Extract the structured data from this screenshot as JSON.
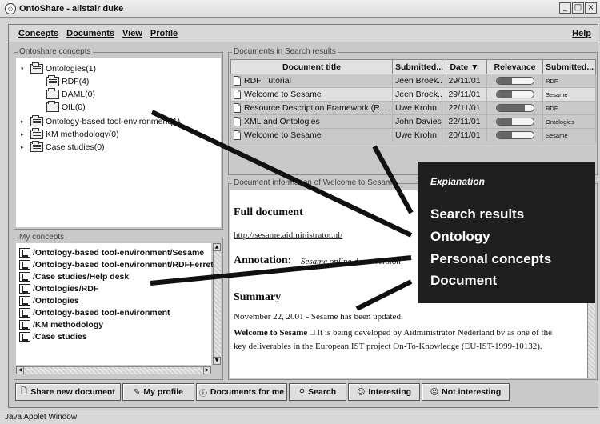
{
  "window": {
    "title": "OntoShare - alistair duke",
    "buttons": [
      "_",
      "□",
      "×"
    ]
  },
  "menu": {
    "items": [
      "Concepts",
      "Documents",
      "View",
      "Profile"
    ],
    "help": "Help"
  },
  "concepts_panel": {
    "label": "Ontoshare concepts",
    "tree": [
      {
        "label": "Ontologies(1)",
        "toggle": "▾"
      },
      {
        "label": "RDF(4)"
      },
      {
        "label": "DAML(0)"
      },
      {
        "label": "OIL(0)"
      },
      {
        "label": "Ontology-based tool-environment(1)",
        "toggle": "▸"
      },
      {
        "label": "KM methodology(0)",
        "toggle": "▸"
      },
      {
        "label": "Case studies(0)",
        "toggle": "▸"
      }
    ]
  },
  "search_panel": {
    "label": "Documents in Search results",
    "columns": [
      "Document title",
      "Submitted...",
      "Date ▼",
      "Relevance",
      "Submitted..."
    ],
    "rows": [
      {
        "title": "RDF Tutorial",
        "submitter": "Jeen Broek...",
        "date": "29/11/01",
        "relevance": 0.42,
        "concept": "RDF"
      },
      {
        "title": "Welcome to Sesame",
        "submitter": "Jeen Broek...",
        "date": "29/11/01",
        "relevance": 0.42,
        "concept": "Sesame"
      },
      {
        "title": "Resource Description Framework (R...",
        "submitter": "Uwe Krohn",
        "date": "22/11/01",
        "relevance": 0.78,
        "concept": "RDF"
      },
      {
        "title": "XML and Ontologies",
        "submitter": "John Davies",
        "date": "22/11/01",
        "relevance": 0.42,
        "concept": "Ontologies"
      },
      {
        "title": "Welcome to Sesame",
        "submitter": "Uwe Krohn",
        "date": "20/11/01",
        "relevance": 0.42,
        "concept": "Sesame"
      }
    ]
  },
  "doc_panel": {
    "label": "Document information of Welcome to Sesame",
    "full_doc_heading": "Full document",
    "link": "http://sesame.aidministrator.nl/",
    "annotation_heading": "Annotation:",
    "annotation_text": "Sesame online demo version",
    "summary_heading": "Summary",
    "summary_date": "November 22, 2001 - Sesame has been updated.",
    "summary_title": "Welcome to Sesame",
    "summary_body": "It is being developed by Aidministrator Nederland bv as one of the key deliverables in the European IST project On-To-Knowledge (EU-IST-1999-10132)."
  },
  "my_concepts": {
    "label": "My concepts",
    "items": [
      "/Ontology-based tool-environment/Sesame",
      "/Ontology-based tool-environment/RDFFerret",
      "/Case studies/Help desk",
      "/Ontologies/RDF",
      "/Ontologies",
      "/Ontology-based tool-environment",
      "/KM methodology",
      "/Case studies"
    ]
  },
  "buttons": [
    {
      "label": "Share new document",
      "icon": "document-icon"
    },
    {
      "label": "My profile",
      "icon": "profile-icon"
    },
    {
      "label": "Documents for me",
      "icon": "info-icon"
    },
    {
      "label": "Search",
      "icon": "search-icon"
    },
    {
      "label": "Interesting",
      "icon": "smiley-icon"
    },
    {
      "label": "Not interesting",
      "icon": "frown-icon"
    }
  ],
  "status": "Java Applet Window",
  "explanation": {
    "title": "Explanation",
    "items": [
      "Search results",
      "Ontology",
      "Personal concepts",
      "Document"
    ]
  }
}
